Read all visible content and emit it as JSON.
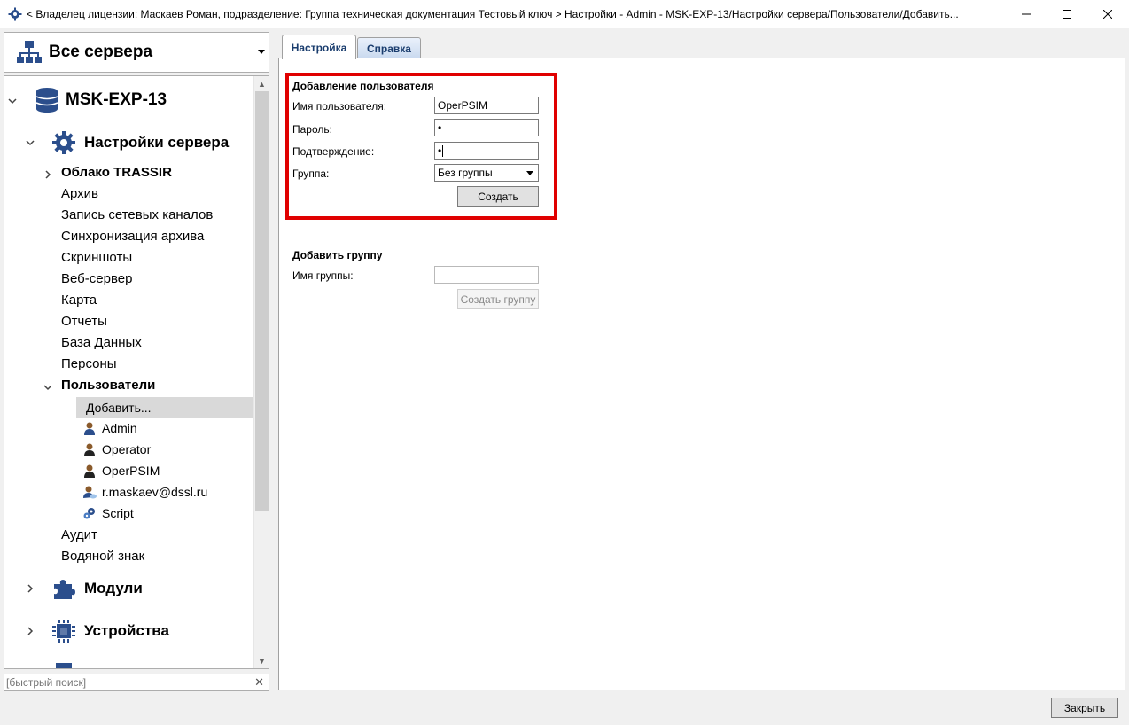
{
  "window": {
    "title": "< Владелец лицензии: Маскаев Роман, подразделение: Группа техническая документация Тестовый ключ > Настройки - Admin - MSK-EXP-13/Настройки сервера/Пользователи/Добавить...",
    "minimize_icon": "minimize-icon",
    "maximize_icon": "maximize-icon",
    "close_icon": "close-icon"
  },
  "server_selector": {
    "label": "Все сервера",
    "icon": "network-icon"
  },
  "tree": {
    "server": "MSK-EXP-13",
    "server_settings": "Настройки сервера",
    "settings_items": [
      "Облако TRASSIR",
      "Архив",
      "Запись сетевых каналов",
      "Синхронизация архива",
      "Скриншоты",
      "Веб-сервер",
      "Карта",
      "Отчеты",
      "База Данных",
      "Персоны",
      "Пользователи"
    ],
    "users_children": [
      "Добавить...",
      "Admin",
      "Operator",
      "OperPSIM",
      "r.maskaev@dssl.ru",
      "Script"
    ],
    "after_users": [
      "Аудит",
      "Водяной знак"
    ],
    "modules": "Модули",
    "devices": "Устройства"
  },
  "search": {
    "placeholder": "[быстрый поиск]",
    "clear_icon": "close-icon"
  },
  "tabs": [
    {
      "label": "Настройка",
      "active": true
    },
    {
      "label": "Справка",
      "active": false
    }
  ],
  "add_user": {
    "heading": "Добавление пользователя",
    "username_label": "Имя пользователя:",
    "username_value": "OperPSIM",
    "password_label": "Пароль:",
    "password_value": "•",
    "confirm_label": "Подтверждение:",
    "confirm_value": "•",
    "group_label": "Группа:",
    "group_value": "Без группы",
    "create_button": "Создать"
  },
  "add_group": {
    "heading": "Добавить группу",
    "group_name_label": "Имя группы:",
    "group_name_value": "",
    "create_group_button": "Создать группу"
  },
  "footer": {
    "close_button": "Закрыть"
  },
  "colors": {
    "highlight": "#e00000",
    "tab_text": "#1a3d6e",
    "icon_blue": "#2b4e8c"
  }
}
